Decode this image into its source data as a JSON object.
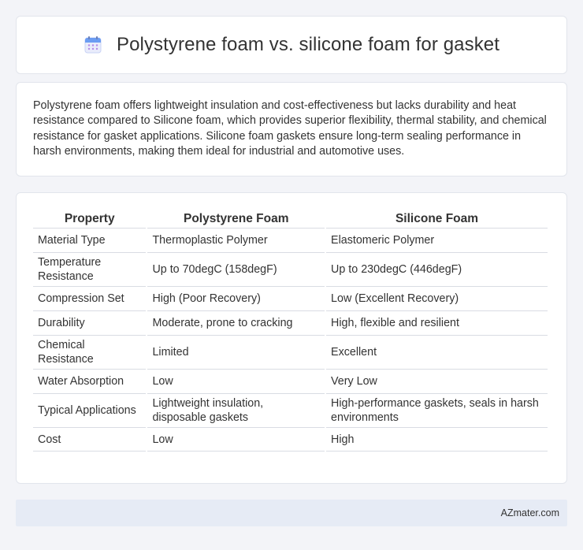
{
  "header": {
    "icon": "calendar-icon",
    "title": "Polystyrene foam vs. silicone foam for gasket"
  },
  "summary": {
    "text": "Polystyrene foam offers lightweight insulation and cost-effectiveness but lacks durability and heat resistance compared to Silicone foam, which provides superior flexibility, thermal stability, and chemical resistance for gasket applications. Silicone foam gaskets ensure long-term sealing performance in harsh environments, making them ideal for industrial and automotive uses."
  },
  "table": {
    "headers": [
      "Property",
      "Polystyrene Foam",
      "Silicone Foam"
    ],
    "rows": [
      {
        "property": "Material Type",
        "polystyrene": "Thermoplastic Polymer",
        "silicone": "Elastomeric Polymer"
      },
      {
        "property": "Temperature Resistance",
        "polystyrene": "Up to 70degC (158degF)",
        "silicone": "Up to 230degC (446degF)"
      },
      {
        "property": "Compression Set",
        "polystyrene": "High (Poor Recovery)",
        "silicone": "Low (Excellent Recovery)"
      },
      {
        "property": "Durability",
        "polystyrene": "Moderate, prone to cracking",
        "silicone": "High, flexible and resilient"
      },
      {
        "property": "Chemical Resistance",
        "polystyrene": "Limited",
        "silicone": "Excellent"
      },
      {
        "property": "Water Absorption",
        "polystyrene": "Low",
        "silicone": "Very Low"
      },
      {
        "property": "Typical Applications",
        "polystyrene": "Lightweight insulation, disposable gaskets",
        "silicone": "High-performance gaskets, seals in harsh environments"
      },
      {
        "property": "Cost",
        "polystyrene": "Low",
        "silicone": "High"
      }
    ]
  },
  "footer": {
    "brand": "AZmater.com"
  },
  "colors": {
    "background": "#f3f4f8",
    "card": "#ffffff",
    "footer": "#e6ebf5",
    "icon_accent": "#5b8def",
    "icon_dots": "#b48be8"
  }
}
